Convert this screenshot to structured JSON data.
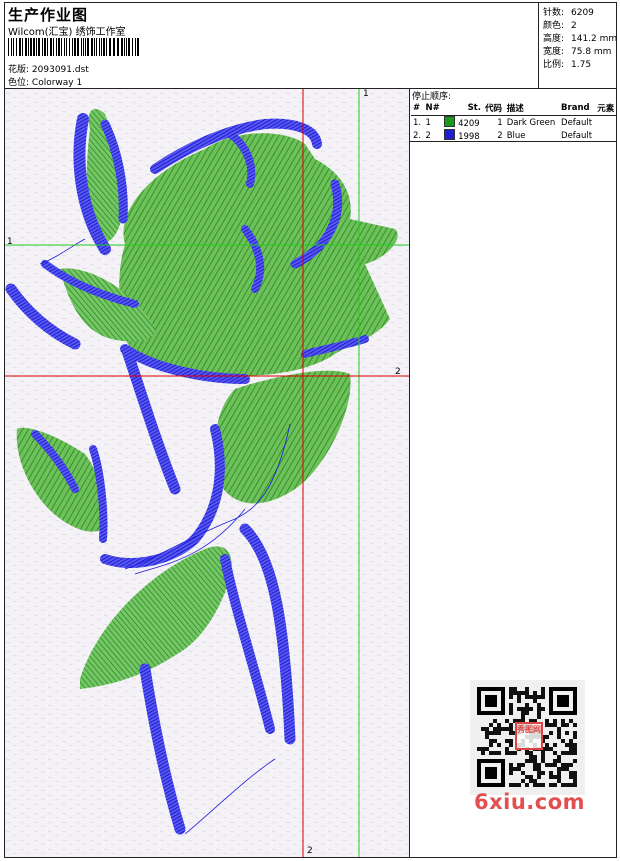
{
  "header": {
    "title": "生产作业图",
    "vendor": "Wilcom(汇宝) 绣饰工作室",
    "design_label": "花版:",
    "design_value": "2093091.dst",
    "colorway_label": "色位:",
    "colorway_value": "Colorway 1"
  },
  "stats": [
    {
      "label": "针数:",
      "value": "6209"
    },
    {
      "label": "颜色:",
      "value": "2"
    },
    {
      "label": "高度:",
      "value": "141.2 mm"
    },
    {
      "label": "宽度:",
      "value": "75.8 mm"
    },
    {
      "label": "比例:",
      "value": "1.75"
    }
  ],
  "stop_sequence": {
    "title": "停止顺序:",
    "columns": [
      "#",
      "N#",
      "St.",
      "代码",
      "描述",
      "Brand",
      "元素"
    ],
    "rows": [
      {
        "index": "1.",
        "n": "1",
        "stitches": "4209",
        "code": "1",
        "description": "Dark Green",
        "brand": "Default",
        "element": "",
        "color": "#1a9a1a"
      },
      {
        "index": "2.",
        "n": "2",
        "stitches": "1998",
        "code": "2",
        "description": "Blue",
        "brand": "Default",
        "element": "",
        "color": "#1f1fd6"
      }
    ]
  },
  "guides": {
    "h_green_label": "1",
    "v_green_label": "1",
    "h_red_label": "2",
    "v_red_label": "2"
  },
  "colors": {
    "thread_green": "#2d9a2d",
    "thread_blue": "#1c1cd8",
    "guide_green": "#22cc22",
    "guide_red": "#dd0000"
  },
  "watermark": {
    "text": "6xiu.com",
    "stamp": "秀图网"
  }
}
